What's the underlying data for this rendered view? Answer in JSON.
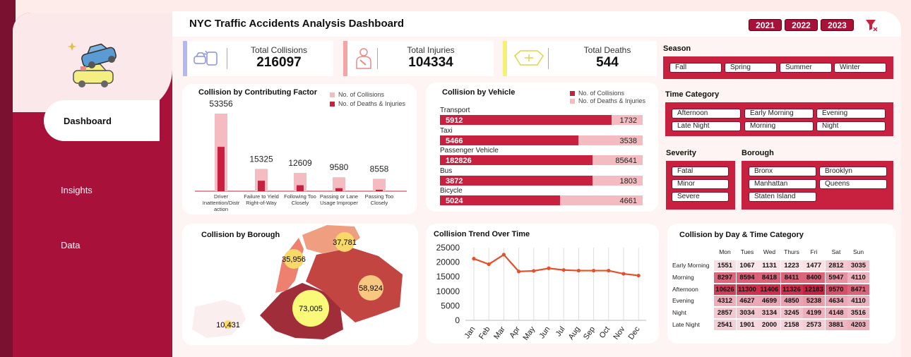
{
  "header": {
    "title": "NYC Traffic Accidents Analysis Dashboard",
    "years": [
      "2021",
      "2022",
      "2023"
    ]
  },
  "nav": {
    "dashboard": "Dashboard",
    "insights": "Insights",
    "data": "Data"
  },
  "kpis": [
    {
      "label": "Total Collisions",
      "value": "216097",
      "color": "#b3b8f0"
    },
    {
      "label": "Total Injuries",
      "value": "104334",
      "color": "#f4a6a6"
    },
    {
      "label": "Total Deaths",
      "value": "544",
      "color": "#f6f07a"
    }
  ],
  "factor_chart": {
    "title": "Collision by Contributing Factor",
    "legend": [
      "No. of Collisions",
      "No. of Deaths & Injuries"
    ],
    "colors": {
      "collisions": "#f4bcc0",
      "deaths_injuries": "#c8213f"
    }
  },
  "vehicle_chart": {
    "title": "Collision by Vehicle",
    "legend": [
      "No. of Collisions",
      "No. of Deaths & Injuries"
    ]
  },
  "borough_map": {
    "title": "Collision by Borough",
    "labels": [
      "37,781",
      "35,956",
      "58,924",
      "73,005",
      "10,431"
    ]
  },
  "trend_chart": {
    "title": "Collision Trend Over Time"
  },
  "heatmap": {
    "title": "Collision by Day & Time Category",
    "days": [
      "Mon",
      "Tues",
      "Wed",
      "Thurs",
      "Fri",
      "Sat",
      "Sun"
    ],
    "categories": [
      "Early Morning",
      "Morning",
      "Afternoon",
      "Evening",
      "Night",
      "Late Night"
    ],
    "values": [
      [
        1551,
        1067,
        1131,
        1223,
        1477,
        2812,
        3035
      ],
      [
        8297,
        8594,
        8418,
        8411,
        8400,
        5947,
        4110
      ],
      [
        10626,
        11300,
        11406,
        11326,
        12183,
        9570,
        8471
      ],
      [
        4312,
        4627,
        4699,
        4850,
        5238,
        4634,
        4110
      ],
      [
        2857,
        3034,
        3134,
        3245,
        4199,
        4148,
        3516
      ],
      [
        2541,
        1901,
        2000,
        2158,
        2573,
        3881,
        4203
      ]
    ]
  },
  "slicers": {
    "season": {
      "title": "Season",
      "items": [
        "Fall",
        "Spring",
        "Summer",
        "Winter"
      ]
    },
    "time_category": {
      "title": "Time Category",
      "items": [
        "Afternoon",
        "Early Morning",
        "Evening",
        "Late Night",
        "Morning",
        "Night"
      ]
    },
    "severity": {
      "title": "Severity",
      "items": [
        "Fatal",
        "Minor",
        "Severe"
      ]
    },
    "borough": {
      "title": "Borough",
      "items": [
        "Bronx",
        "Brooklyn",
        "Manhattan",
        "Queens",
        "Staten Island"
      ]
    }
  },
  "chart_data": [
    {
      "type": "bar",
      "title": "Collision by Contributing Factor",
      "categories": [
        "Driver Inattention/Distraction",
        "Failure to Yield Right-of-Way",
        "Following Too Closely",
        "Passing or Lane Usage Improper",
        "Passing Too Closely"
      ],
      "category_labels": [
        [
          "Driver",
          "Inattention/Distr",
          "action"
        ],
        [
          "Failure to Yield",
          "Right-of-Way"
        ],
        [
          "Following Too",
          "Closely"
        ],
        [
          "Passing or Lane",
          "Usage Improper"
        ],
        [
          "Passing Too",
          "Closely"
        ]
      ],
      "series": [
        {
          "name": "No. of Collisions",
          "values": [
            53356,
            15325,
            12609,
            9580,
            8558
          ]
        },
        {
          "name": "No. of Deaths & Injuries",
          "values": [
            30500,
            7200,
            4100,
            2100,
            1000
          ]
        }
      ]
    },
    {
      "type": "bar",
      "title": "Collision by Vehicle",
      "categories": [
        "Transport",
        "Taxi",
        "Passenger Vehicle",
        "Bus",
        "Bicycle"
      ],
      "series": [
        {
          "name": "No. of Deaths & Injuries",
          "values": [
            5912,
            5466,
            182826,
            3872,
            5024
          ]
        },
        {
          "name": "No. of Collisions",
          "values": [
            1732,
            3538,
            85641,
            1803,
            4661
          ]
        }
      ]
    },
    {
      "type": "line",
      "title": "Collision Trend Over Time",
      "categories": [
        "Jan",
        "Feb",
        "Mar",
        "Apr",
        "May",
        "Jun",
        "Jul",
        "Aug",
        "Sep",
        "Oct",
        "Nov",
        "Dec"
      ],
      "values": [
        21200,
        19300,
        22600,
        16800,
        17000,
        17900,
        17300,
        17100,
        17100,
        17100,
        16000,
        15400
      ],
      "yticks": [
        0,
        5000,
        10000,
        15000,
        20000,
        25000
      ],
      "ylim": [
        0,
        25000
      ]
    }
  ]
}
